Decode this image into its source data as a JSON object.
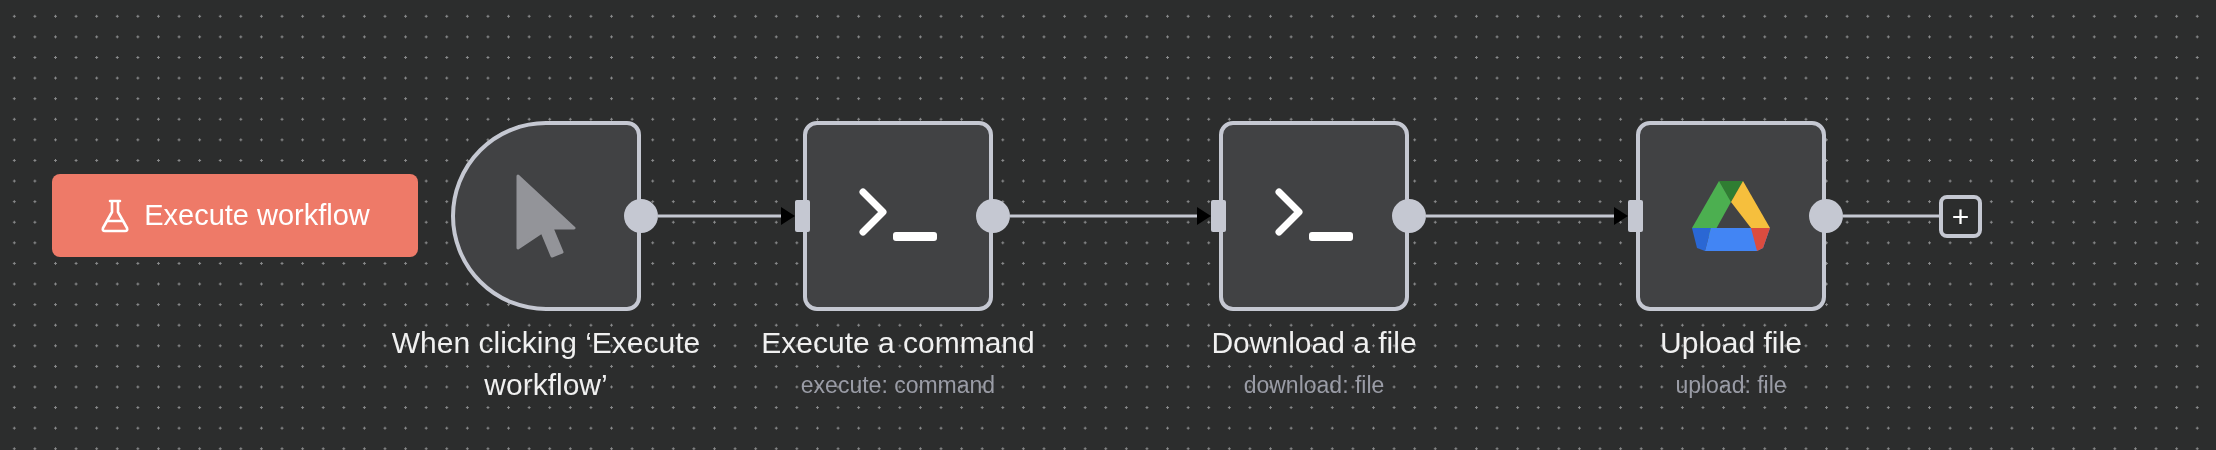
{
  "run_button": {
    "label": "Execute workflow"
  },
  "nodes": [
    {
      "kind": "trigger",
      "title": "When clicking ‘Execute workflow’"
    },
    {
      "kind": "command",
      "title": "Execute a command",
      "subtitle": "execute: command"
    },
    {
      "kind": "command",
      "title": "Download a file",
      "subtitle": "download: file"
    },
    {
      "kind": "drive",
      "title": "Upload file",
      "subtitle": "upload: file"
    }
  ],
  "add_button": {
    "label": "+"
  }
}
